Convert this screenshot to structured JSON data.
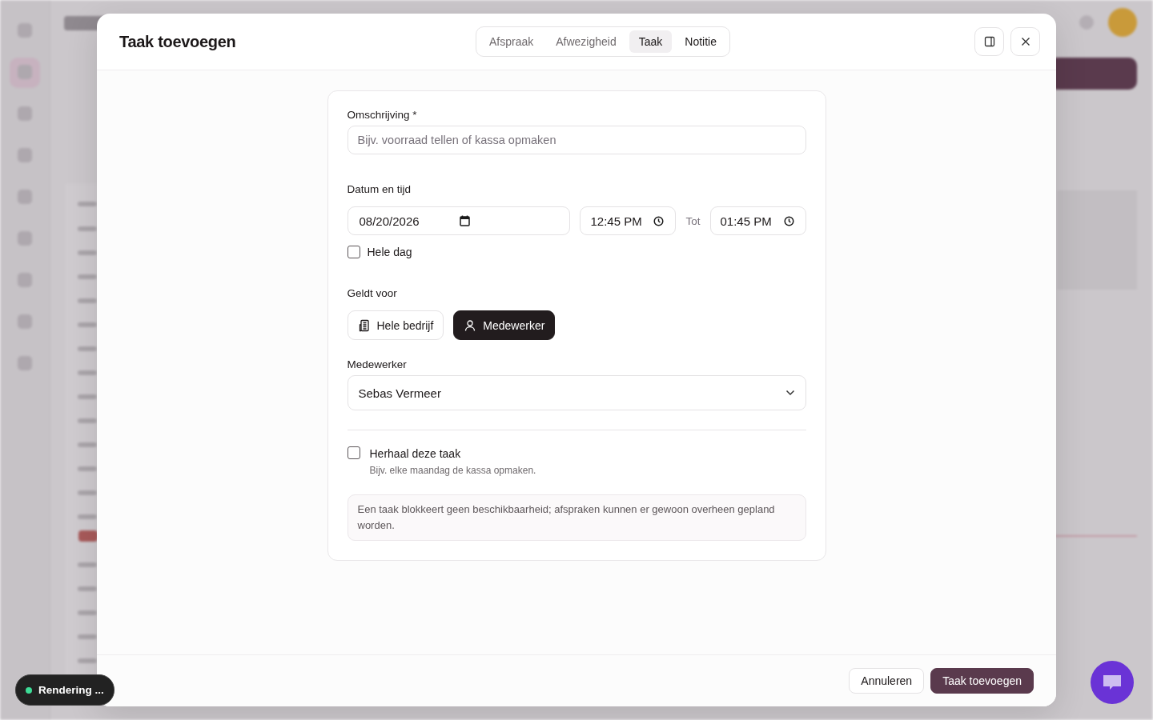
{
  "dialog": {
    "title": "Taak toevoegen",
    "tabs": [
      {
        "label": "Afspraak",
        "selected": false,
        "hovered": false
      },
      {
        "label": "Afwezigheid",
        "selected": false,
        "hovered": false
      },
      {
        "label": "Taak",
        "selected": true,
        "hovered": false
      },
      {
        "label": "Notitie",
        "selected": false,
        "hovered": true
      }
    ],
    "form": {
      "description": {
        "label": "Omschrijving *",
        "placeholder": "Bijv. voorraad tellen of kassa opmaken"
      },
      "datetime": {
        "label": "Datum en tijd",
        "date": "08/20/2026",
        "start_time": "12:45 PM",
        "separator": "Tot",
        "end_time": "01:45 PM",
        "all_day": {
          "label": "Hele dag",
          "checked": false
        }
      },
      "applies_to": {
        "label": "Geldt voor",
        "options": [
          {
            "label": "Hele bedrijf",
            "kind": "building",
            "selected": false
          },
          {
            "label": "Medewerker",
            "kind": "person",
            "selected": true
          }
        ]
      },
      "employee": {
        "label": "Medewerker",
        "value": "Sebas Vermeer"
      },
      "repeat": {
        "label": "Herhaal deze taak",
        "hint": "Bijv. elke maandag de kassa opmaken.",
        "checked": false
      },
      "note": "Een taak blokkeert geen beschikbaarheid; afspraken kunnen er gewoon overheen gepland worden."
    },
    "buttons": [
      {
        "label": "Annuleren",
        "kind": "secondary"
      },
      {
        "label": "Taak toevoegen",
        "kind": "primary"
      }
    ]
  },
  "toast": {
    "text": "Rendering ..."
  }
}
